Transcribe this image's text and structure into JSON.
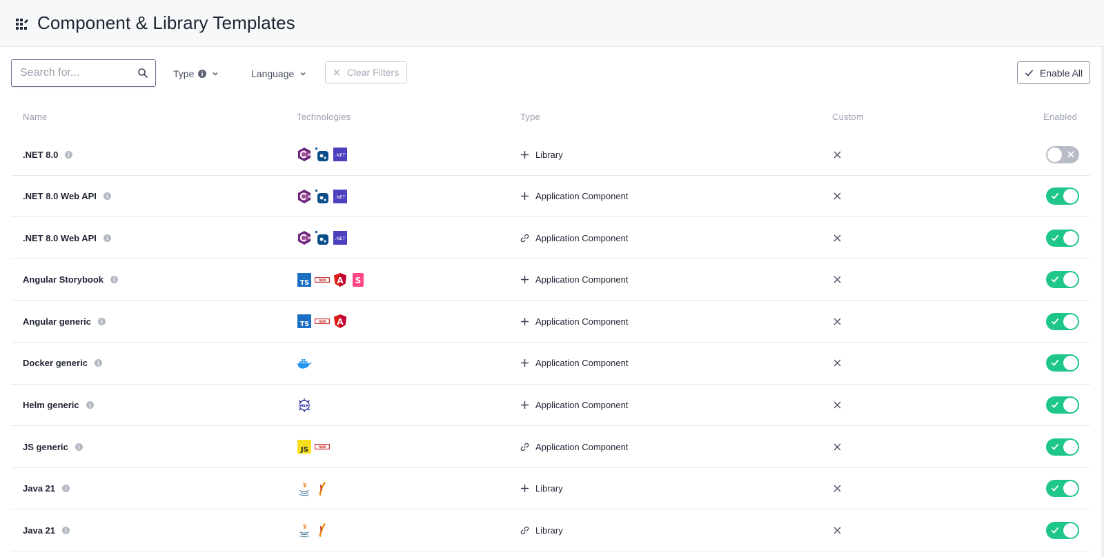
{
  "page": {
    "title": "Component & Library Templates",
    "title_icon": "grid-icon"
  },
  "toolbar": {
    "search_placeholder": "Search for...",
    "type_filter_label": "Type",
    "language_filter_label": "Language",
    "clear_filters_label": "Clear Filters",
    "enable_all_label": "Enable All"
  },
  "table": {
    "columns": {
      "name": "Name",
      "technologies": "Technologies",
      "type": "Type",
      "custom": "Custom",
      "enabled": "Enabled"
    },
    "rows": [
      {
        "name": ".NET 8.0",
        "technologies": [
          "csharp-icon",
          "dotnet-core-icon",
          "dotnet-icon"
        ],
        "type": "Library",
        "type_icon": "plus-icon",
        "custom": false,
        "enabled": false
      },
      {
        "name": ".NET 8.0 Web API",
        "technologies": [
          "csharp-icon",
          "dotnet-core-icon",
          "dotnet-icon"
        ],
        "type": "Application Component",
        "type_icon": "plus-icon",
        "custom": false,
        "enabled": true
      },
      {
        "name": ".NET 8.0 Web API",
        "technologies": [
          "csharp-icon",
          "dotnet-core-icon",
          "dotnet-icon"
        ],
        "type": "Application Component",
        "type_icon": "link-icon",
        "custom": false,
        "enabled": true
      },
      {
        "name": "Angular Storybook",
        "technologies": [
          "typescript-icon",
          "npm-icon",
          "angular-icon",
          "storybook-icon"
        ],
        "type": "Application Component",
        "type_icon": "plus-icon",
        "custom": false,
        "enabled": true
      },
      {
        "name": "Angular generic",
        "technologies": [
          "typescript-icon",
          "npm-icon",
          "angular-icon"
        ],
        "type": "Application Component",
        "type_icon": "plus-icon",
        "custom": false,
        "enabled": true
      },
      {
        "name": "Docker generic",
        "technologies": [
          "docker-icon"
        ],
        "type": "Application Component",
        "type_icon": "plus-icon",
        "custom": false,
        "enabled": true
      },
      {
        "name": "Helm generic",
        "technologies": [
          "helm-icon"
        ],
        "type": "Application Component",
        "type_icon": "plus-icon",
        "custom": false,
        "enabled": true
      },
      {
        "name": "JS generic",
        "technologies": [
          "javascript-icon",
          "npm-icon"
        ],
        "type": "Application Component",
        "type_icon": "link-icon",
        "custom": false,
        "enabled": true
      },
      {
        "name": "Java 21",
        "technologies": [
          "java-icon",
          "maven-icon"
        ],
        "type": "Library",
        "type_icon": "plus-icon",
        "custom": false,
        "enabled": true
      },
      {
        "name": "Java 21",
        "technologies": [
          "java-icon",
          "maven-icon"
        ],
        "type": "Library",
        "type_icon": "link-icon",
        "custom": false,
        "enabled": true
      }
    ]
  },
  "colors": {
    "toggle_on": "#1fc68a",
    "toggle_off": "#b8bcc6",
    "text_primary": "#1f2333",
    "text_muted": "#9aa0ae"
  },
  "tech_labels": {
    "dotnet": ".NET",
    "typescript": "TS",
    "npm": "npm",
    "angular": "A",
    "storybook": "S",
    "javascript": "JS",
    "helm": "HELM"
  }
}
